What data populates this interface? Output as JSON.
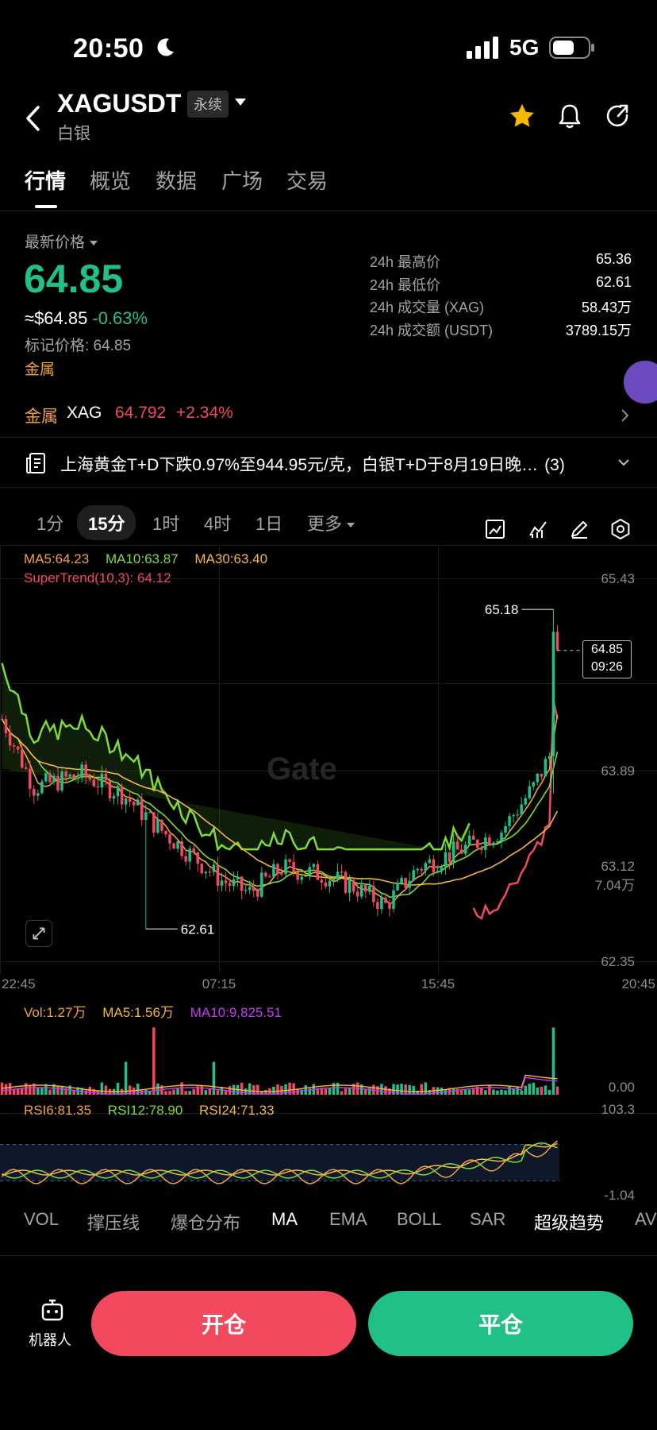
{
  "status_bar": {
    "time": "20:50",
    "network": "5G"
  },
  "header": {
    "symbol": "XAGUSDT",
    "contract_type": "永续",
    "name": "白银"
  },
  "tabs": [
    {
      "label": "行情",
      "active": true
    },
    {
      "label": "概览",
      "active": false
    },
    {
      "label": "数据",
      "active": false
    },
    {
      "label": "广场",
      "active": false
    },
    {
      "label": "交易",
      "active": false
    }
  ],
  "price": {
    "latest_label": "最新价格",
    "last": "64.85",
    "usd_approx": "≈$64.85",
    "change_pct": "-0.63%",
    "mark_price": "标记价格: 64.85",
    "category": "金属"
  },
  "stats": [
    {
      "label": "24h 最高价",
      "value": "65.36"
    },
    {
      "label": "24h 最低价",
      "value": "62.61"
    },
    {
      "label": "24h 成交量 (XAG)",
      "value": "58.43万"
    },
    {
      "label": "24h 成交额 (USDT)",
      "value": "3789.15万"
    }
  ],
  "related": {
    "category": "金属",
    "symbol": "XAG",
    "price": "64.792",
    "change": "+2.34%"
  },
  "news": {
    "text": "上海黄金T+D下跌0.97%至944.95元/克，白银T+D于8月19日晚…",
    "count": "(3)"
  },
  "intervals": [
    {
      "label": "1分",
      "active": false
    },
    {
      "label": "15分",
      "active": true
    },
    {
      "label": "1时",
      "active": false
    },
    {
      "label": "4时",
      "active": false
    },
    {
      "label": "1日",
      "active": false
    },
    {
      "label": "更多",
      "active": false
    }
  ],
  "chart_toolbar": [
    "chart-style-icon",
    "indicator-icon",
    "draw-pen-icon",
    "settings-icon"
  ],
  "legend": {
    "ma5": "MA5:64.23",
    "ma10": "MA10:63.87",
    "ma30": "MA30:63.40",
    "supertrend": "SuperTrend(10,3): 64.12",
    "vol": "Vol:1.27万",
    "vol_ma5": "MA5:1.56万",
    "vol_ma10": "MA10:9,825.51",
    "rsi6": "RSI6:81.35",
    "rsi12": "RSI12:78.90",
    "rsi24": "RSI24:71.33"
  },
  "price_marker": {
    "price": "64.85",
    "countdown": "09:26"
  },
  "watermark": "Gate",
  "chart_data": {
    "type": "candlestick",
    "y_ticks": [
      "65.43",
      "63.89",
      "63.12",
      "62.35"
    ],
    "x_ticks": [
      "22:45",
      "07:15",
      "15:45",
      "20:45"
    ],
    "high_label": "65.18",
    "low_label": "62.61",
    "vol_ticks": [
      "7.04万",
      "0.00"
    ],
    "rsi_ticks": [
      "103.3",
      "-1.04"
    ],
    "ylim": [
      62.35,
      65.43
    ],
    "last": 64.85,
    "up_color": "#21c087",
    "down_color": "#f2495e"
  },
  "indicator_tabs": [
    {
      "label": "VOL",
      "on": false
    },
    {
      "label": "撑压线",
      "on": false
    },
    {
      "label": "爆仓分布",
      "on": false
    },
    {
      "label": "MA",
      "on": true
    },
    {
      "label": "EMA",
      "on": false
    },
    {
      "label": "BOLL",
      "on": false
    },
    {
      "label": "SAR",
      "on": false
    },
    {
      "label": "超级趋势",
      "on": true
    },
    {
      "label": "AV",
      "on": false
    }
  ],
  "bottom": {
    "bot_label": "机器人",
    "open_label": "开仓",
    "close_label": "平仓"
  }
}
